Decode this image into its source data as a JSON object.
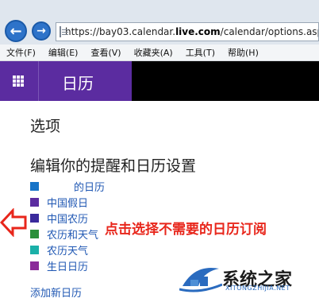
{
  "browser": {
    "url_prefix": "https://bay03.calendar.",
    "url_domain": "live.com",
    "url_suffix": "/calendar/options.aspx"
  },
  "menu": {
    "items": [
      "文件(F)",
      "编辑(E)",
      "查看(V)",
      "收藏夹(A)",
      "工具(T)",
      "帮助(H)"
    ]
  },
  "app": {
    "title": "日历"
  },
  "page": {
    "section_title": "选项",
    "subtitle": "编辑你的提醒和日历设置"
  },
  "calendars": [
    {
      "label": "的日历",
      "color": "#1673c7"
    },
    {
      "label": "中国假日",
      "color": "#5b2ca0"
    },
    {
      "label": "中国农历",
      "color": "#3a2a9c"
    },
    {
      "label": "农历和天气",
      "color": "#2a8f3a"
    },
    {
      "label": "农历天气",
      "color": "#1ab0a8"
    },
    {
      "label": "生日日历",
      "color": "#8a2b99"
    }
  ],
  "add_calendar": "添加新日历",
  "annotation": "点击选择不需要的日历订阅",
  "watermark": {
    "title": "系统之家",
    "subtitle": "XITONGZHIJIA.NET"
  },
  "colors": {
    "brand_purple": "#5b2ca0",
    "link_blue": "#1f57b3",
    "annotation_red": "#e8261b"
  }
}
